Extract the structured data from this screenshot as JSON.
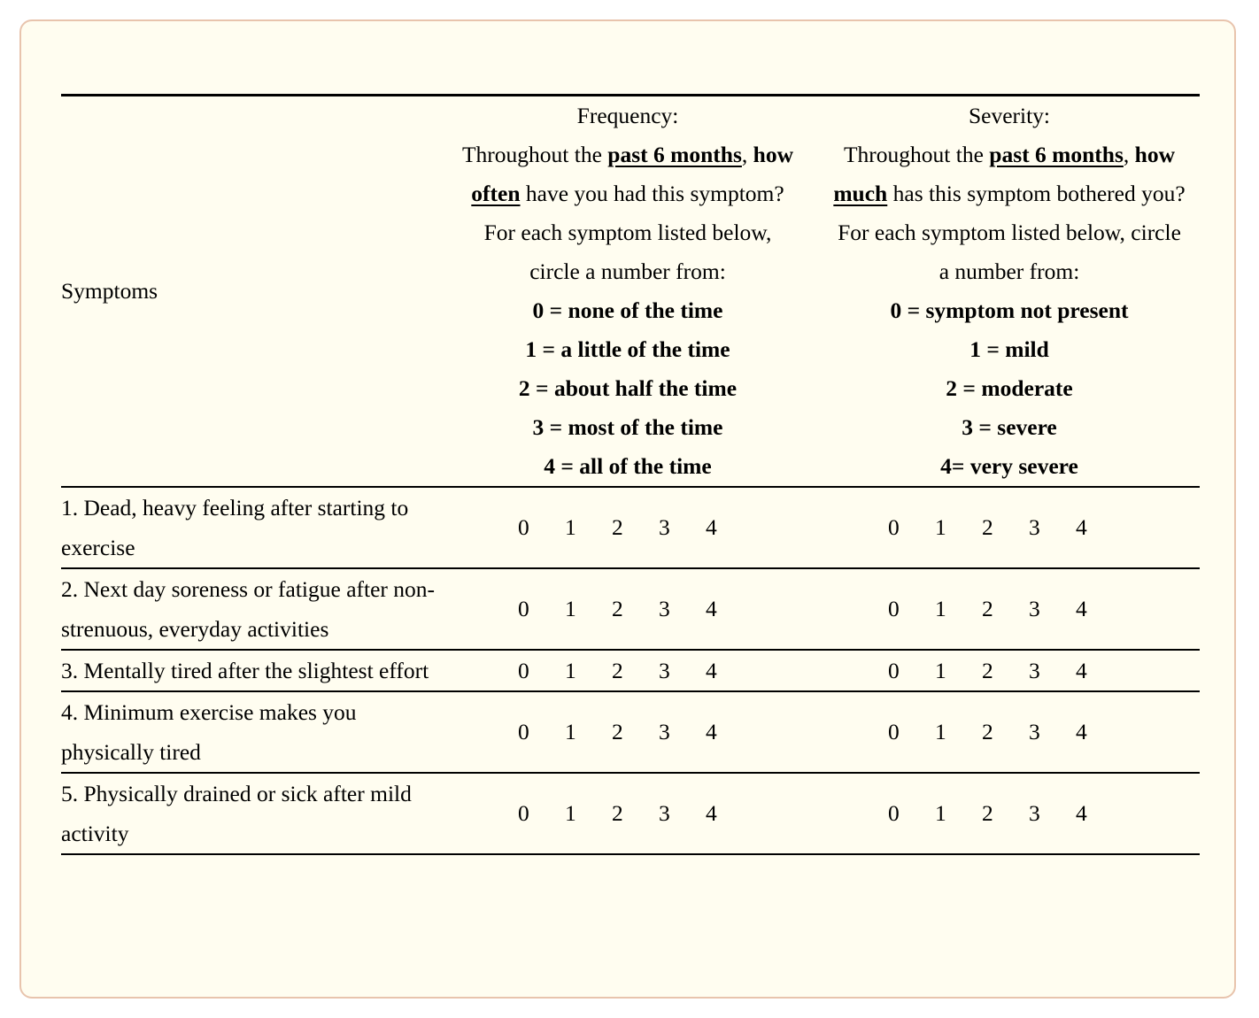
{
  "card": {
    "background": "#fffdf0",
    "border_color": "#e8c4ad"
  },
  "table": {
    "symptoms_column_header": "Symptoms",
    "frequency_column": {
      "title": "Frequency:",
      "prompt_line_1_pre": "Throughout the ",
      "prompt_line_1_bold_underline": "past 6 months",
      "prompt_line_1_post": ", ",
      "prompt_line_1_bold": "how",
      "prompt_line_2_bold_underline": "often",
      "prompt_line_2_post": " have you had this symptom?",
      "instruction_line_1": "For each symptom listed below,",
      "instruction_line_2": "circle a number from:",
      "scale": [
        "0 = none of the time",
        "1 = a little of the time",
        "2 = about half the time",
        "3 = most of the time",
        "4 = all of the time"
      ]
    },
    "severity_column": {
      "title": "Severity:",
      "prompt_line_1_pre": "Throughout the ",
      "prompt_line_1_bold_underline": "past 6 months",
      "prompt_line_1_post": ", ",
      "prompt_line_1_bold": "how",
      "prompt_line_2_bold_underline": "much",
      "prompt_line_2_post": " has this symptom bothered you?",
      "instruction_line_1": "For each symptom listed below, circle",
      "instruction_line_2": "a number from:",
      "scale": [
        "0 = symptom not present",
        "1 = mild",
        "2 = moderate",
        "3 = severe",
        "4= very severe"
      ]
    },
    "response_options": [
      "0",
      "1",
      "2",
      "3",
      "4"
    ],
    "rows": [
      {
        "symptom": "1. Dead, heavy feeling after starting to exercise",
        "frequency_options": [
          "0",
          "1",
          "2",
          "3",
          "4"
        ],
        "severity_options": [
          "0",
          "1",
          "2",
          "3",
          "4"
        ]
      },
      {
        "symptom": "2. Next day soreness or fatigue after non-strenuous, everyday activities",
        "frequency_options": [
          "0",
          "1",
          "2",
          "3",
          "4"
        ],
        "severity_options": [
          "0",
          "1",
          "2",
          "3",
          "4"
        ]
      },
      {
        "symptom": "3. Mentally tired after the slightest effort",
        "frequency_options": [
          "0",
          "1",
          "2",
          "3",
          "4"
        ],
        "severity_options": [
          "0",
          "1",
          "2",
          "3",
          "4"
        ]
      },
      {
        "symptom": "4. Minimum exercise makes you physically tired",
        "frequency_options": [
          "0",
          "1",
          "2",
          "3",
          "4"
        ],
        "severity_options": [
          "0",
          "1",
          "2",
          "3",
          "4"
        ]
      },
      {
        "symptom": "5. Physically drained or sick after mild activity",
        "frequency_options": [
          "0",
          "1",
          "2",
          "3",
          "4"
        ],
        "severity_options": [
          "0",
          "1",
          "2",
          "3",
          "4"
        ]
      }
    ]
  }
}
